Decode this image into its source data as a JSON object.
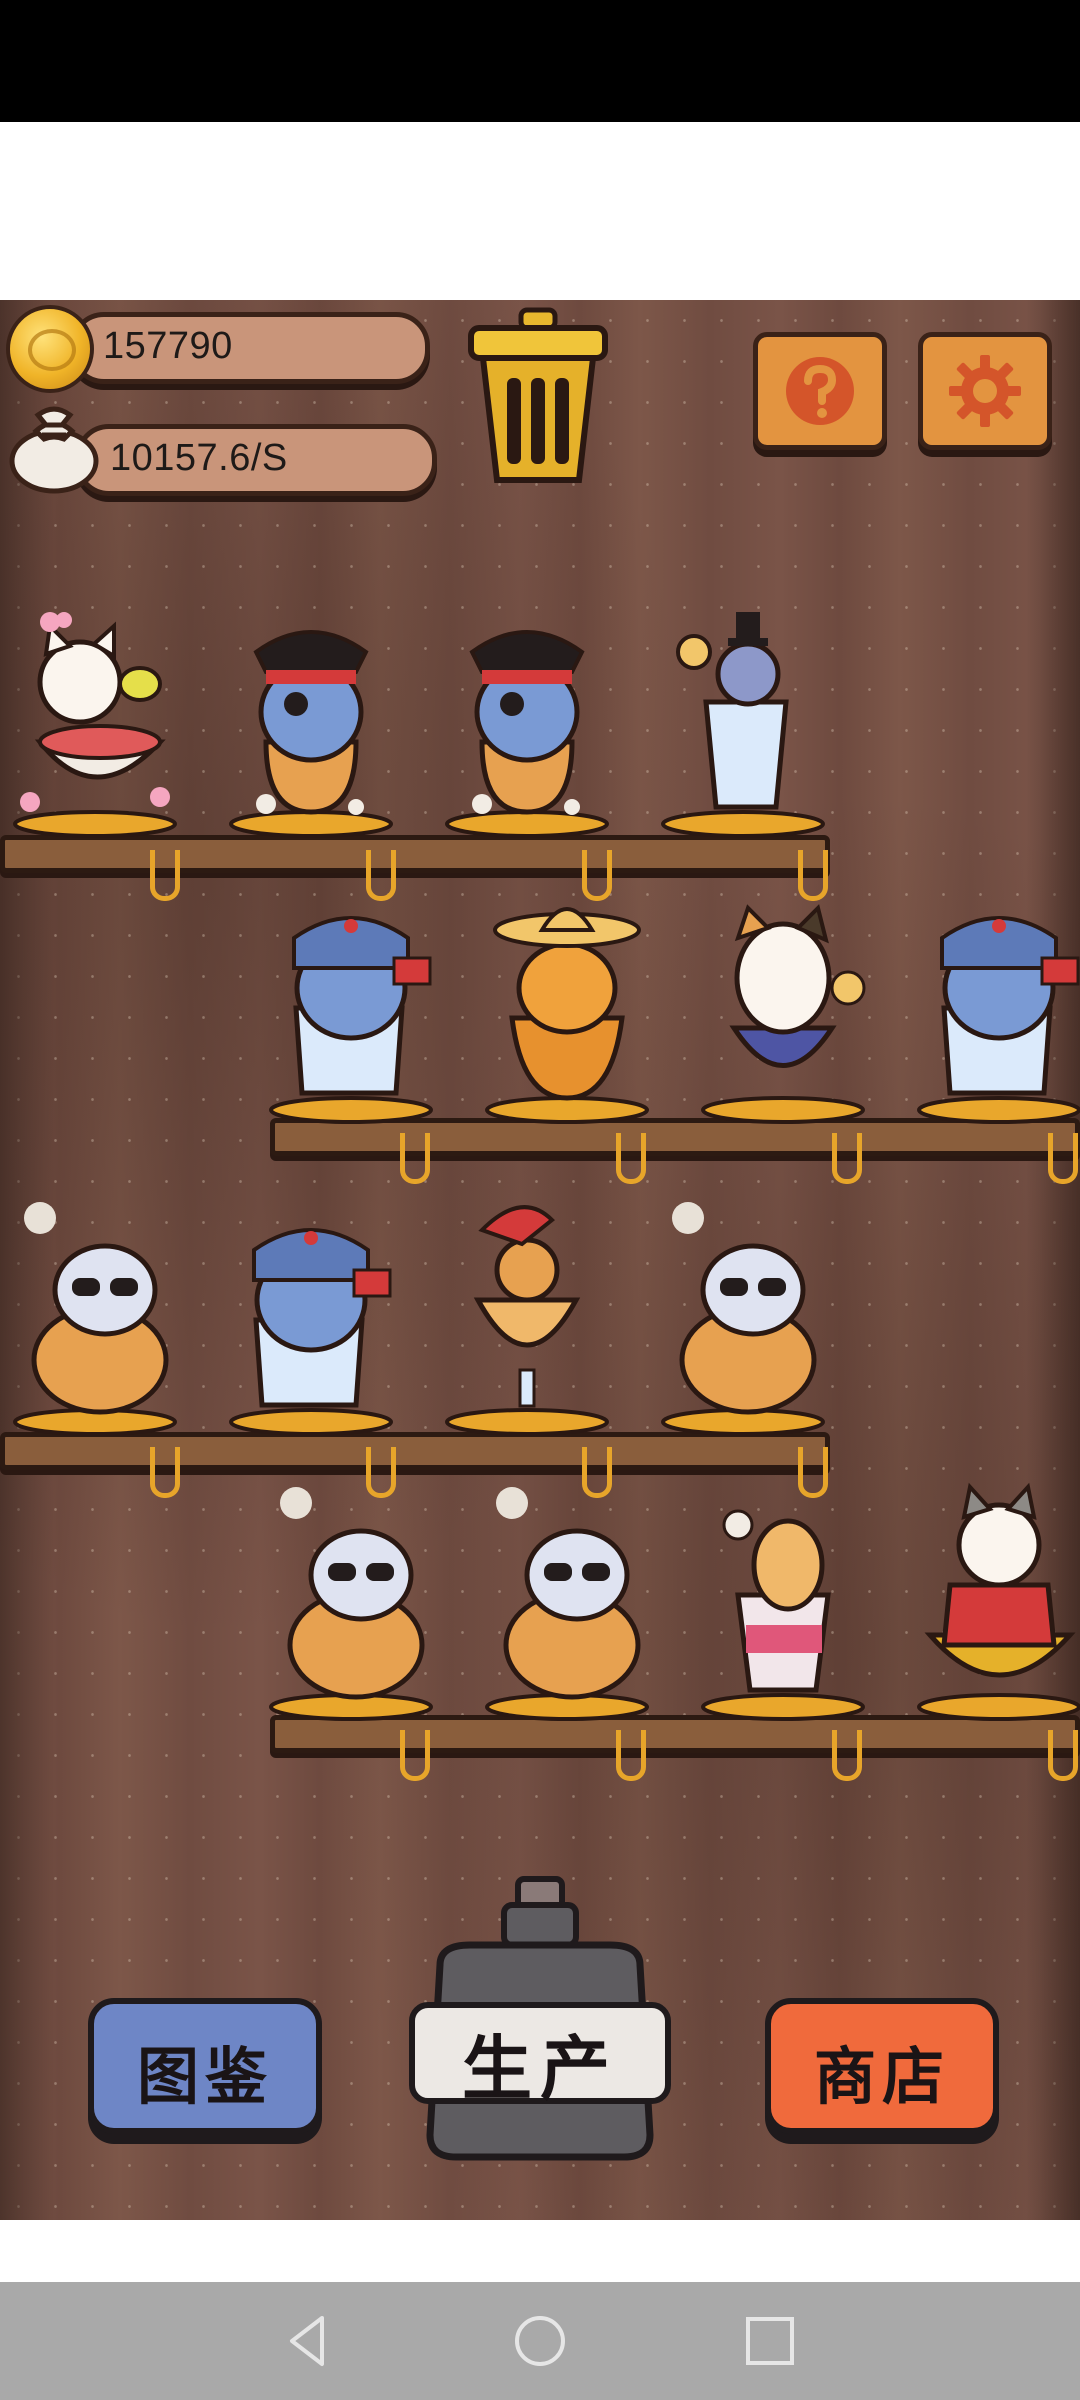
{
  "hud": {
    "coins": "157790",
    "rate": "10157.6/S",
    "icons": [
      "coin-icon",
      "money-bag-icon",
      "trash-can-icon",
      "help-icon",
      "settings-gear-icon"
    ]
  },
  "colors": {
    "background_wood": "#7a5448",
    "shelf": "#8a5e3c",
    "help_button": "#e39440",
    "codex_button": "#6e86c6",
    "shop_button": "#f06a3c",
    "produce_bottle": "#5e5c60",
    "nav_bar": "#a9a9a9"
  },
  "shelves": [
    {
      "cats": [
        "flower-cat-in-bowl",
        "pirate-cat",
        "pirate-cat",
        "top-hat-cat-in-drink-glass"
      ]
    },
    {
      "cats": [
        "ushanka-cat-in-glass",
        "sombrero-tabby-cat",
        "calico-cat-in-bowl",
        "ushanka-cat-in-glass"
      ]
    },
    {
      "cats": [
        "sunglasses-cat-in-pot",
        "ushanka-cat-in-glass",
        "red-hat-cat-in-parfait-glass",
        "sunglasses-cat-in-pot"
      ]
    },
    {
      "cats": [
        "sunglasses-cat-in-pot",
        "sunglasses-cat-in-pot",
        "alpaca-cat-in-cup",
        "red-coat-cat-in-bowl"
      ]
    }
  ],
  "buttons": {
    "codex": "图鉴",
    "produce": "生产",
    "shop": "商店"
  },
  "navigation": {
    "icons": [
      "back-icon",
      "home-icon",
      "recents-icon"
    ]
  }
}
